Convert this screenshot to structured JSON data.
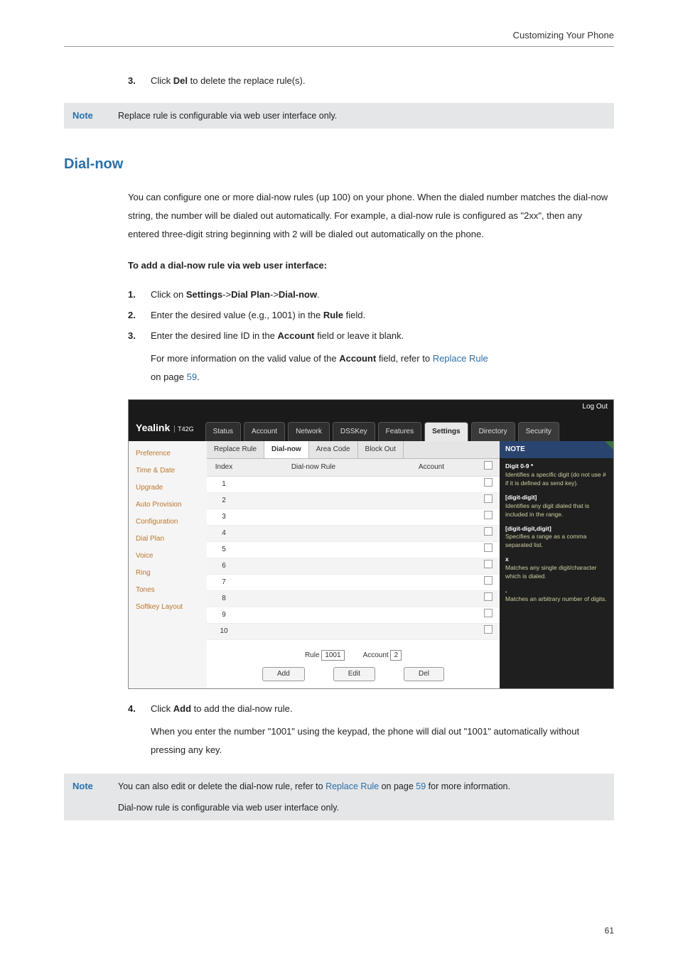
{
  "header": {
    "breadcrumb": "Customizing Your Phone"
  },
  "step3_pre": {
    "num": "3.",
    "prefix": "Click ",
    "bold": "Del",
    "suffix": " to delete the replace rule(s)."
  },
  "note1": {
    "label": "Note",
    "text": "Replace rule is configurable via web user interface only."
  },
  "section_heading": "Dial-now",
  "intro": "You can configure one or more dial-now rules (up 100) on your phone. When the dialed number matches the dial-now string, the number will be dialed out automatically. For example, a dial-now rule is configured as \"2xx\", then any entered three-digit string beginning with 2 will be dialed out automatically on the phone.",
  "subhead": "To add a dial-now rule via web user interface:",
  "steps": {
    "s1": {
      "num": "1.",
      "prefix": "Click on ",
      "b1": "Settings",
      "sep1": "->",
      "b2": "Dial Plan",
      "sep2": "->",
      "b3": "Dial-now",
      "suffix": "."
    },
    "s2": {
      "num": "2.",
      "prefix": "Enter the desired value (e.g., 1001) in the ",
      "bold": "Rule",
      "suffix": " field."
    },
    "s3": {
      "num": "3.",
      "prefix": "Enter the desired line ID in the ",
      "bold": "Account",
      "suffix": " field or leave it blank."
    },
    "s3_sub_prefix": "For more information on the valid value of the ",
    "s3_sub_bold": "Account",
    "s3_sub_mid": " field, refer to ",
    "s3_sub_link": "Replace Rule",
    "s3_sub_tail_prefix": "on page ",
    "s3_sub_page": "59",
    "s3_sub_tail_suffix": ".",
    "s4": {
      "num": "4.",
      "prefix": "Click ",
      "bold": "Add",
      "suffix": " to add the dial-now rule."
    },
    "s4_sub": "When you enter the number \"1001\" using the keypad, the phone will dial out \"1001\" automatically without pressing any key."
  },
  "note2": {
    "label": "Note",
    "line1_prefix": "You can also edit or delete the dial-now rule, refer to ",
    "line1_link": "Replace Rule",
    "line1_mid": " on page ",
    "line1_page": "59",
    "line1_suffix": " for more information.",
    "line2": "Dial-now rule is configurable via web user interface only."
  },
  "screenshot": {
    "logout": "Log Out",
    "logo": "Yealink",
    "logo_sub": "T42G",
    "tabs": [
      "Status",
      "Account",
      "Network",
      "DSSKey",
      "Features",
      "Settings",
      "Directory",
      "Security"
    ],
    "active_tab": "Settings",
    "side": [
      "Preference",
      "Time & Date",
      "Upgrade",
      "Auto Provision",
      "Configuration",
      "Dial Plan",
      "Voice",
      "Ring",
      "Tones",
      "Softkey Layout"
    ],
    "subtabs": [
      "Replace Rule",
      "Dial-now",
      "Area Code",
      "Block Out"
    ],
    "active_subtab": "Dial-now",
    "th": {
      "index": "Index",
      "rule": "Dial-now Rule",
      "account": "Account",
      "chk": ""
    },
    "rows": [
      "1",
      "2",
      "3",
      "4",
      "5",
      "6",
      "7",
      "8",
      "9",
      "10"
    ],
    "form": {
      "rule_label": "Rule",
      "rule_value": "1001",
      "acct_label": "Account",
      "acct_value": "2"
    },
    "btns": {
      "add": "Add",
      "edit": "Edit",
      "del": "Del"
    },
    "note": {
      "head": "NOTE",
      "items": [
        {
          "h": "Digit 0-9 *",
          "t": "Identifies a specific digit (do not use # if it is defined as send key)."
        },
        {
          "h": "[digit-digit]",
          "t": "Identifies any digit dialed that is included in the range."
        },
        {
          "h": "[digit-digit,digit]",
          "t": "Specifies a range as a comma separated list."
        },
        {
          "h": "x",
          "t": "Matches any single digit/character which is dialed."
        },
        {
          "h": ".",
          "t": "Matches an arbitrary number of digits."
        }
      ]
    }
  },
  "pagenum": "61"
}
